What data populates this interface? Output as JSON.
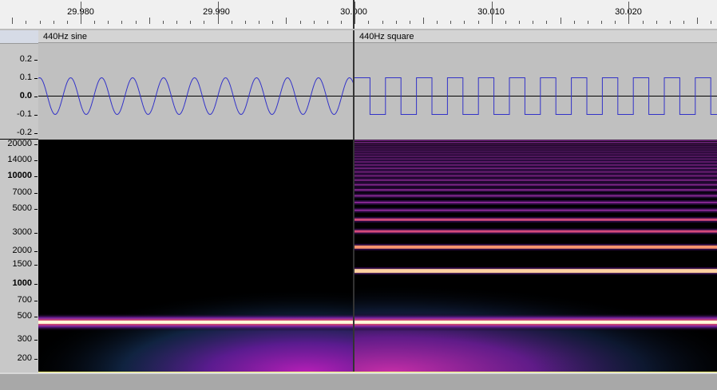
{
  "ruler": {
    "labels": [
      "29.980",
      "29.990",
      "30.000",
      "30.010",
      "30.020"
    ]
  },
  "clips": [
    {
      "title": "440Hz sine"
    },
    {
      "title": "440Hz square"
    }
  ],
  "waveform_axis": [
    "0.2",
    "0.1",
    "0.0",
    "-0.1",
    "-0.2"
  ],
  "spectrogram_axis": [
    {
      "label": "20000",
      "bold": false
    },
    {
      "label": "14000",
      "bold": false
    },
    {
      "label": "10000",
      "bold": true
    },
    {
      "label": "7000",
      "bold": false
    },
    {
      "label": "5000",
      "bold": false
    },
    {
      "label": "3000",
      "bold": false
    },
    {
      "label": "2000",
      "bold": false
    },
    {
      "label": "1500",
      "bold": false
    },
    {
      "label": "1000",
      "bold": true
    },
    {
      "label": "700",
      "bold": false
    },
    {
      "label": "500",
      "bold": false
    },
    {
      "label": "300",
      "bold": false
    },
    {
      "label": "200",
      "bold": false
    }
  ],
  "colors": {
    "waveform": "#3232c8",
    "background": "#c0c0c0",
    "spectrogram_hot": "#fff8c0",
    "spectrogram_mid": "#ff5050",
    "spectrogram_low": "#8020a0"
  },
  "signals": {
    "sine_frequency_hz": 440,
    "square_frequency_hz": 440,
    "amplitude": 0.1
  }
}
